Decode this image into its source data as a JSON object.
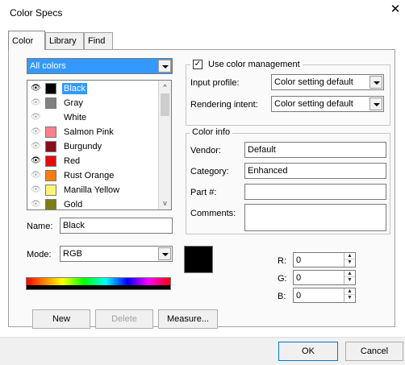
{
  "window": {
    "title": "Color Specs",
    "close_glyph": "✕"
  },
  "tabs": [
    {
      "label": "Color"
    },
    {
      "label": "Library"
    },
    {
      "label": "Find"
    }
  ],
  "filter": {
    "selected": "All colors"
  },
  "colors": [
    {
      "name": "Black",
      "swatch": "#000000",
      "visible": true,
      "selected": true
    },
    {
      "name": "Gray",
      "swatch": "#808080",
      "visible": false,
      "selected": false
    },
    {
      "name": "White",
      "swatch": "#ffffff",
      "visible": false,
      "selected": false
    },
    {
      "name": "Salmon Pink",
      "swatch": "#f7818b",
      "visible": false,
      "selected": false
    },
    {
      "name": "Burgundy",
      "swatch": "#8a0f1d",
      "visible": false,
      "selected": false
    },
    {
      "name": "Red",
      "swatch": "#e30d0d",
      "visible": true,
      "selected": false
    },
    {
      "name": "Rust Orange",
      "swatch": "#f57e12",
      "visible": false,
      "selected": false
    },
    {
      "name": "Manilla Yellow",
      "swatch": "#fff27a",
      "visible": false,
      "selected": false
    },
    {
      "name": "Gold",
      "swatch": "#7d7d16",
      "visible": false,
      "selected": false
    }
  ],
  "name_field": {
    "label": "Name:",
    "value": "Black"
  },
  "mode": {
    "label": "Mode:",
    "value": "RGB"
  },
  "color_management": {
    "checkbox_label": "Use color management",
    "checked": true,
    "input_profile": {
      "label": "Input profile:",
      "value": "Color setting default"
    },
    "rendering_intent": {
      "label": "Rendering intent:",
      "value": "Color setting default"
    }
  },
  "color_info": {
    "title": "Color info",
    "vendor": {
      "label": "Vendor:",
      "value": "Default"
    },
    "category": {
      "label": "Category:",
      "value": "Enhanced"
    },
    "part": {
      "label": "Part #:",
      "value": ""
    },
    "comments": {
      "label": "Comments:",
      "value": ""
    }
  },
  "rgb": {
    "r": {
      "label": "R:",
      "value": "0"
    },
    "g": {
      "label": "G:",
      "value": "0"
    },
    "b": {
      "label": "B:",
      "value": "0"
    }
  },
  "buttons": {
    "new": "New",
    "delete": "Delete",
    "measure": "Measure...",
    "ok": "OK",
    "cancel": "Cancel"
  },
  "colors_theme": {
    "selection": "#3399ff",
    "preview": "#000000"
  }
}
